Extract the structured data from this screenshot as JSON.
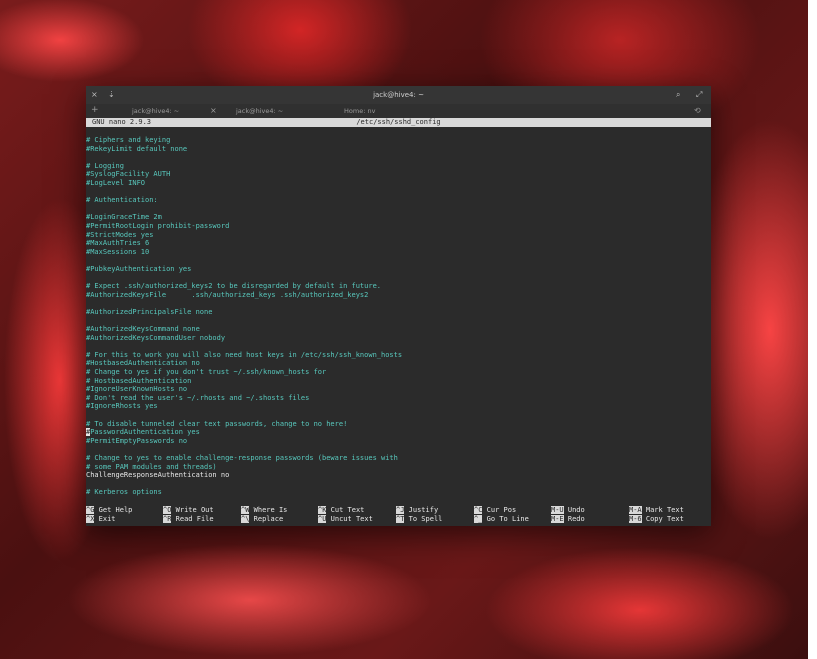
{
  "window": {
    "title": "jack@hive4: ~",
    "close_glyph": "×",
    "pin_glyph": "⇣",
    "search_glyph": "⌕",
    "maximize_glyph": "⤢"
  },
  "tabs": {
    "add_glyph": "+",
    "items": [
      {
        "label": "jack@hive4: ~"
      },
      {
        "label": "jack@hive4: ~"
      },
      {
        "label": "Home: nv"
      }
    ],
    "close_glyph": "×",
    "history_glyph": "⟲"
  },
  "nano": {
    "version": "GNU nano 2.9.3",
    "file": "/etc/ssh/sshd_config"
  },
  "lines": [
    {
      "text": "# Ciphers and keying"
    },
    {
      "text": "#RekeyLimit default none"
    },
    {
      "text": ""
    },
    {
      "text": "# Logging"
    },
    {
      "text": "#SyslogFacility AUTH"
    },
    {
      "text": "#LogLevel INFO"
    },
    {
      "text": ""
    },
    {
      "text": "# Authentication:"
    },
    {
      "text": ""
    },
    {
      "text": "#LoginGraceTime 2m"
    },
    {
      "text": "#PermitRootLogin prohibit-password"
    },
    {
      "text": "#StrictModes yes"
    },
    {
      "text": "#MaxAuthTries 6"
    },
    {
      "text": "#MaxSessions 10"
    },
    {
      "text": ""
    },
    {
      "text": "#PubkeyAuthentication yes"
    },
    {
      "text": ""
    },
    {
      "text": "# Expect .ssh/authorized_keys2 to be disregarded by default in future."
    },
    {
      "text": "#AuthorizedKeysFile      .ssh/authorized_keys .ssh/authorized_keys2"
    },
    {
      "text": ""
    },
    {
      "text": "#AuthorizedPrincipalsFile none"
    },
    {
      "text": ""
    },
    {
      "text": "#AuthorizedKeysCommand none"
    },
    {
      "text": "#AuthorizedKeysCommandUser nobody"
    },
    {
      "text": ""
    },
    {
      "text": "# For this to work you will also need host keys in /etc/ssh/ssh_known_hosts"
    },
    {
      "text": "#HostbasedAuthentication no"
    },
    {
      "text": "# Change to yes if you don't trust ~/.ssh/known_hosts for"
    },
    {
      "text": "# HostbasedAuthentication"
    },
    {
      "text": "#IgnoreUserKnownHosts no"
    },
    {
      "text": "# Don't read the user's ~/.rhosts and ~/.shosts files"
    },
    {
      "text": "#IgnoreRhosts yes"
    },
    {
      "text": ""
    },
    {
      "text": "# To disable tunneled clear text passwords, change to no here!"
    },
    {
      "text": "#PasswordAuthentication yes",
      "cursor": true
    },
    {
      "text": "#PermitEmptyPasswords no"
    },
    {
      "text": ""
    },
    {
      "text": "# Change to yes to enable challenge-response passwords (beware issues with"
    },
    {
      "text": "# some PAM modules and threads)"
    },
    {
      "text": "ChallengeResponseAuthentication no",
      "plain": true
    },
    {
      "text": ""
    },
    {
      "text": "# Kerberos options"
    }
  ],
  "shortcuts": [
    {
      "key": "^G",
      "label": "Get Help"
    },
    {
      "key": "^X",
      "label": "Exit"
    },
    {
      "key": "^O",
      "label": "Write Out"
    },
    {
      "key": "^R",
      "label": "Read File"
    },
    {
      "key": "^W",
      "label": "Where Is"
    },
    {
      "key": "^\\",
      "label": "Replace"
    },
    {
      "key": "^K",
      "label": "Cut Text"
    },
    {
      "key": "^U",
      "label": "Uncut Text"
    },
    {
      "key": "^J",
      "label": "Justify"
    },
    {
      "key": "^T",
      "label": "To Spell"
    },
    {
      "key": "^C",
      "label": "Cur Pos"
    },
    {
      "key": "^_",
      "label": "Go To Line"
    },
    {
      "key": "M-U",
      "label": "Undo"
    },
    {
      "key": "M-E",
      "label": "Redo"
    },
    {
      "key": "M-A",
      "label": "Mark Text"
    },
    {
      "key": "M-6",
      "label": "Copy Text"
    }
  ],
  "colors": {
    "comment": "#58c8bd",
    "text": "#e8e8e8",
    "bar": "#d9d9d9"
  }
}
